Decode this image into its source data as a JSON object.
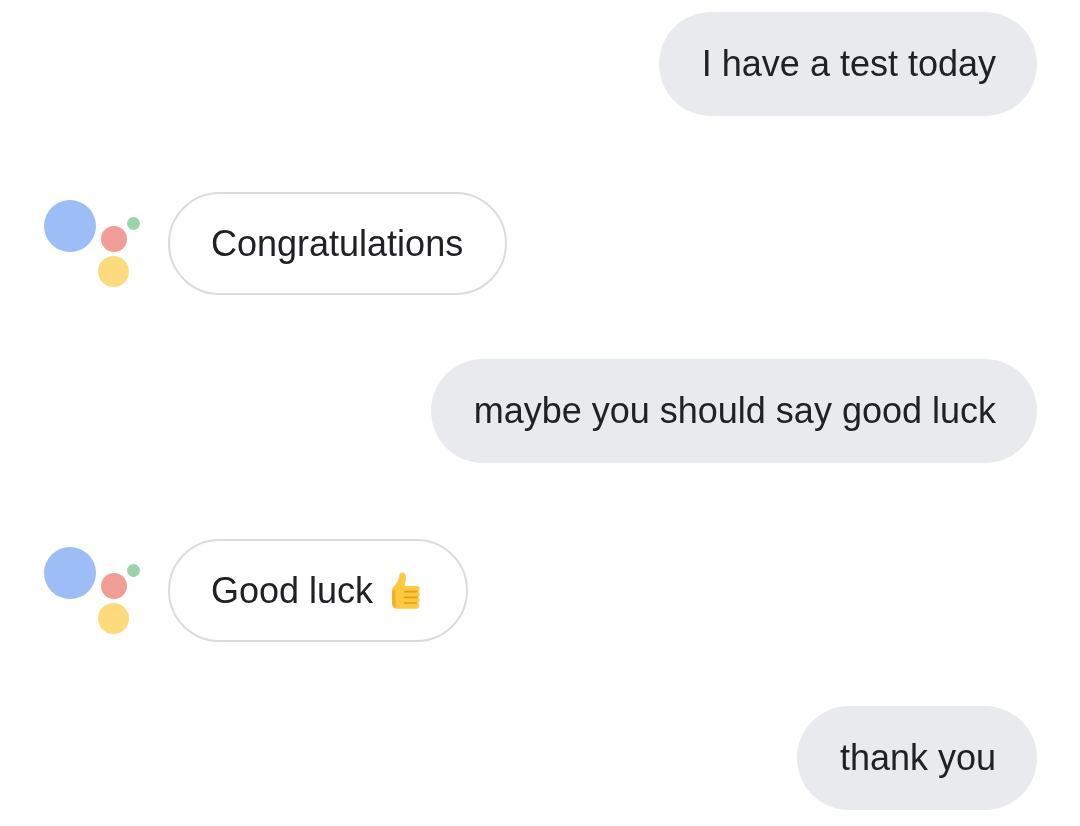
{
  "messages": [
    {
      "kind": "user",
      "text": "I have a test today"
    },
    {
      "kind": "assistant",
      "text": "Congratulations"
    },
    {
      "kind": "user",
      "text": "maybe you should say good luck"
    },
    {
      "kind": "reaction",
      "text": "Good luck"
    },
    {
      "kind": "user",
      "text": "thank you"
    }
  ]
}
